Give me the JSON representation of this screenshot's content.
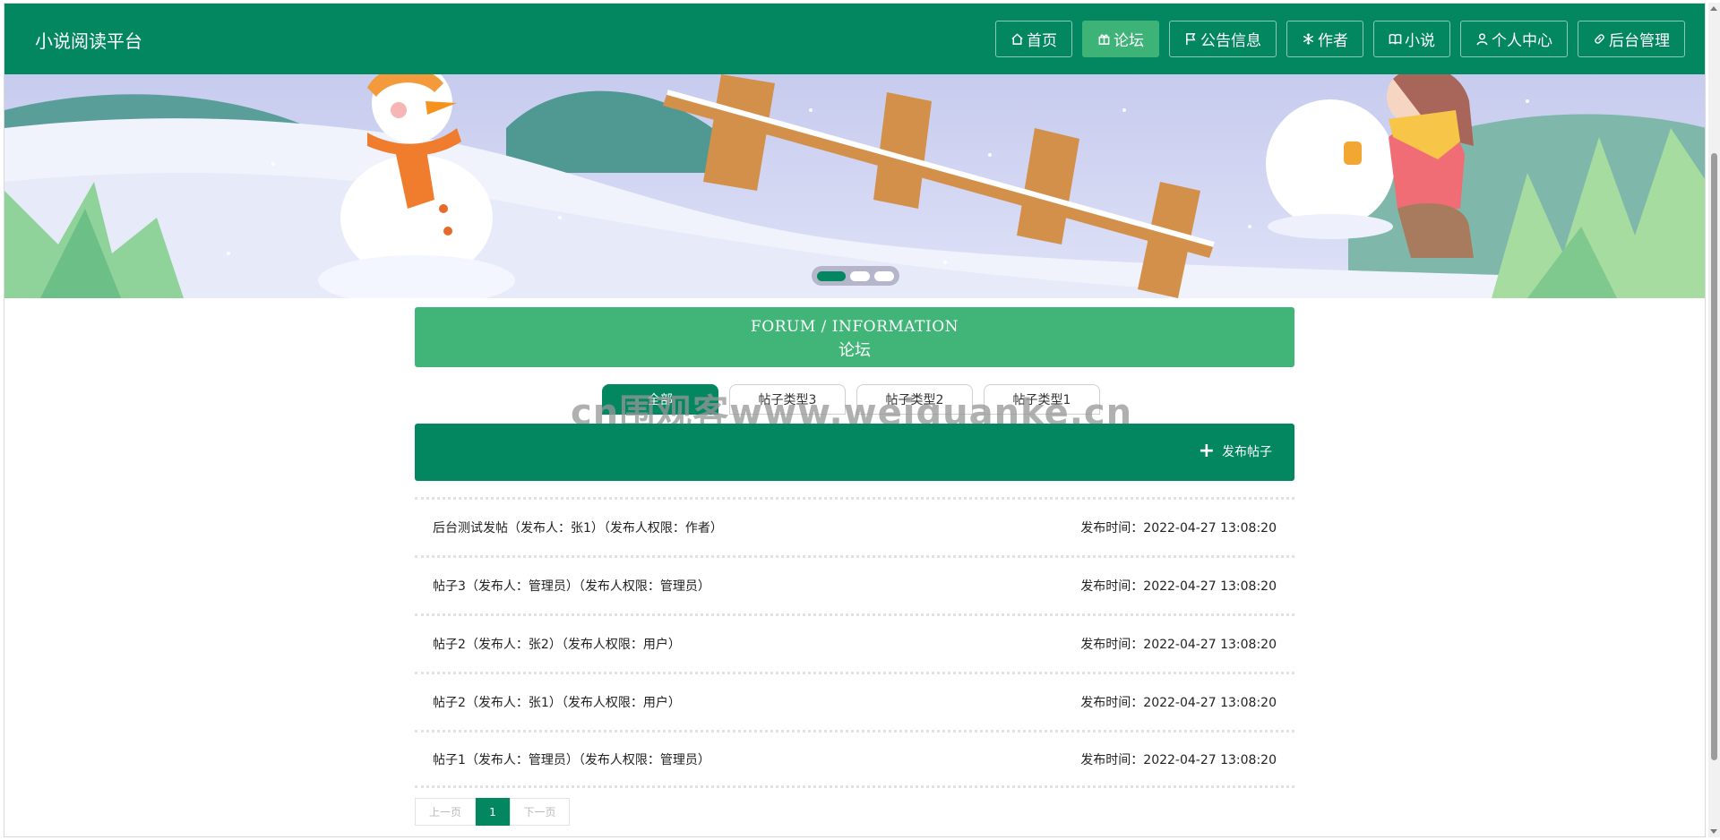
{
  "header": {
    "brand": "小说阅读平台",
    "nav": [
      {
        "label": "首页",
        "icon": "home-icon"
      },
      {
        "label": "论坛",
        "icon": "gift-icon",
        "active": true
      },
      {
        "label": "公告信息",
        "icon": "flag-icon"
      },
      {
        "label": "作者",
        "icon": "snowflake-icon"
      },
      {
        "label": "小说",
        "icon": "book-icon"
      },
      {
        "label": "个人中心",
        "icon": "user-icon"
      },
      {
        "label": "后台管理",
        "icon": "link-icon"
      }
    ]
  },
  "colors": {
    "primary": "#028760",
    "accent": "#40b577",
    "nav_active": "#3db377"
  },
  "banner": {
    "slides": 3,
    "active_slide": 1
  },
  "forum": {
    "title_en": "FORUM / INFORMATION",
    "title_zh": "论坛"
  },
  "tabs": [
    "全部",
    "帖子类型3",
    "帖子类型2",
    "帖子类型1"
  ],
  "watermark": "cn围观客www.weiguanke.cn",
  "post_button": "发布帖子",
  "posts": [
    {
      "title": "后台测试发帖（发布人：张1）（发布人权限：作者）",
      "time": "发布时间：2022-04-27 13:08:20"
    },
    {
      "title": "帖子3（发布人：管理员）（发布人权限：管理员）",
      "time": "发布时间：2022-04-27 13:08:20"
    },
    {
      "title": "帖子2（发布人：张2）（发布人权限：用户）",
      "time": "发布时间：2022-04-27 13:08:20"
    },
    {
      "title": "帖子2（发布人：张1）（发布人权限：用户）",
      "time": "发布时间：2022-04-27 13:08:20"
    },
    {
      "title": "帖子1（发布人：管理员）（发布人权限：管理员）",
      "time": "发布时间：2022-04-27 13:08:20"
    }
  ],
  "pager": {
    "prev": "上一页",
    "current": "1",
    "next": "下一页"
  }
}
